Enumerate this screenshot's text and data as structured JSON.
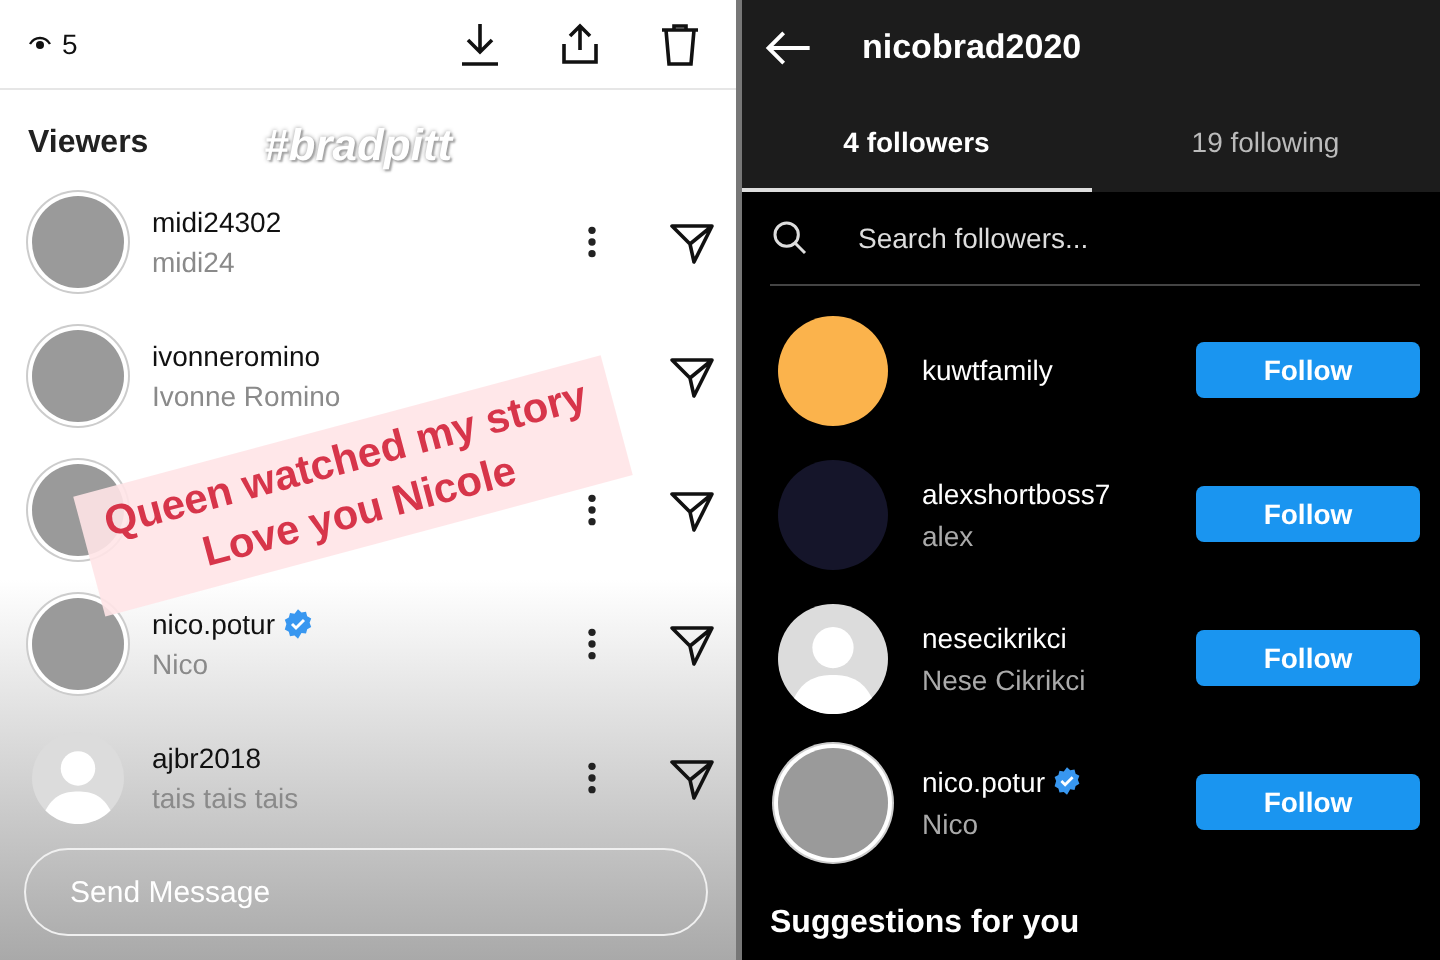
{
  "story_viewers": {
    "view_count": "5",
    "section_title": "Viewers",
    "viewers": [
      {
        "username": "midi24302",
        "name": "midi24",
        "verified": false,
        "avatar": {
          "kind": "photo"
        },
        "menu": true
      },
      {
        "username": "ivonneromino",
        "name": "Ivonne Romino",
        "verified": false,
        "avatar": {
          "kind": "photo"
        },
        "menu": false
      },
      {
        "avatar": {
          "kind": "photo"
        },
        "menu": true
      },
      {
        "username": "nico.potur",
        "name": "Nico",
        "verified": true,
        "avatar": {
          "kind": "photo"
        },
        "menu": true
      },
      {
        "username": "ajbr2018",
        "name": "tais tais tais",
        "verified": false,
        "avatar": {
          "kind": "default"
        },
        "menu": true
      }
    ],
    "stickers": [
      {
        "kind": "hashtag",
        "text": "#bradpitt"
      },
      {
        "kind": "caption",
        "lines": [
          "Queen watched my story",
          "Love you Nicole"
        ]
      }
    ],
    "message_field": {
      "placeholder": "Send Message"
    }
  },
  "followers_screen": {
    "title": "nicobrad2020",
    "tabs": [
      {
        "label": "4 followers",
        "selected": true
      },
      {
        "label": "19 following",
        "selected": false
      }
    ],
    "search": {
      "placeholder": "Search followers..."
    },
    "followers": [
      {
        "username": "kuwtfamily",
        "verified": false,
        "avatar": {
          "kind": "color",
          "color": "#fbb34c"
        },
        "button": "Follow"
      },
      {
        "username": "alexshortboss7",
        "name": "alex",
        "verified": false,
        "avatar": {
          "kind": "color",
          "color": "#15152a"
        },
        "button": "Follow"
      },
      {
        "username": "nesecikrikci",
        "name": "Nese Cikrikci",
        "verified": false,
        "avatar": {
          "kind": "default"
        },
        "button": "Follow"
      },
      {
        "username": "nico.potur",
        "name": "Nico",
        "verified": true,
        "avatar": {
          "kind": "photo"
        },
        "button": "Follow"
      }
    ],
    "section_title": "Suggestions for you"
  }
}
